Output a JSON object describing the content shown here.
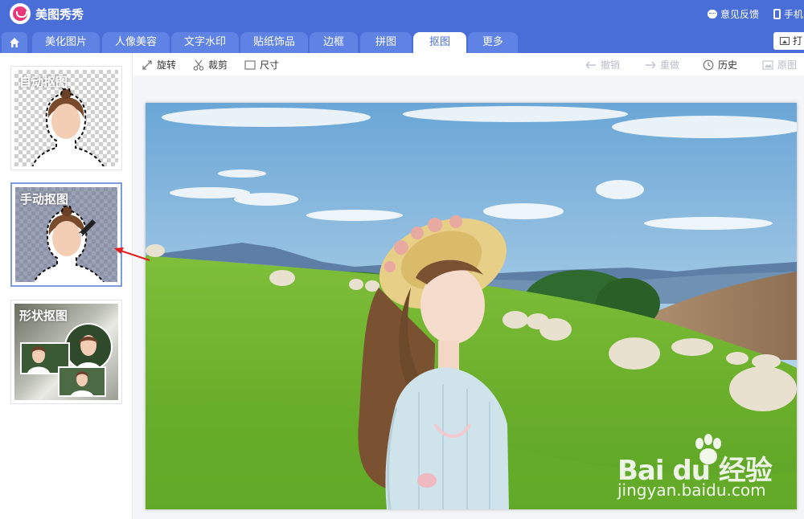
{
  "app": {
    "title": "美图秀秀",
    "feedback_label": "意见反馈",
    "phone_label": "手机",
    "print_label": "打"
  },
  "tabs": [
    {
      "label": "美化图片"
    },
    {
      "label": "人像美容"
    },
    {
      "label": "文字水印"
    },
    {
      "label": "贴纸饰品"
    },
    {
      "label": "边框"
    },
    {
      "label": "拼图"
    },
    {
      "label": "抠图",
      "active": true
    },
    {
      "label": "更多"
    }
  ],
  "cutout_modes": [
    {
      "label": "自动抠图"
    },
    {
      "label": "手动抠图",
      "selected": true
    },
    {
      "label": "形状抠图"
    }
  ],
  "toolbar": {
    "rotate": "旋转",
    "crop": "裁剪",
    "size": "尺寸",
    "undo": "撤销",
    "redo": "重做",
    "history": "历史",
    "original": "原图"
  },
  "watermark": {
    "brand": "Bai du 经验",
    "url": "jingyan.baidu.com"
  },
  "colors": {
    "header_blue": "#4a6ed8",
    "tab_blue": "#5f83e4",
    "active_tab_text": "#4a6ed8",
    "selection_border": "#7e9be0",
    "annotation_arrow": "#e02020"
  },
  "icons": [
    "home-icon",
    "chat-icon",
    "phone-icon",
    "rotate-icon",
    "scissors-icon",
    "size-icon",
    "undo-icon",
    "redo-icon",
    "history-icon",
    "original-image-icon"
  ]
}
